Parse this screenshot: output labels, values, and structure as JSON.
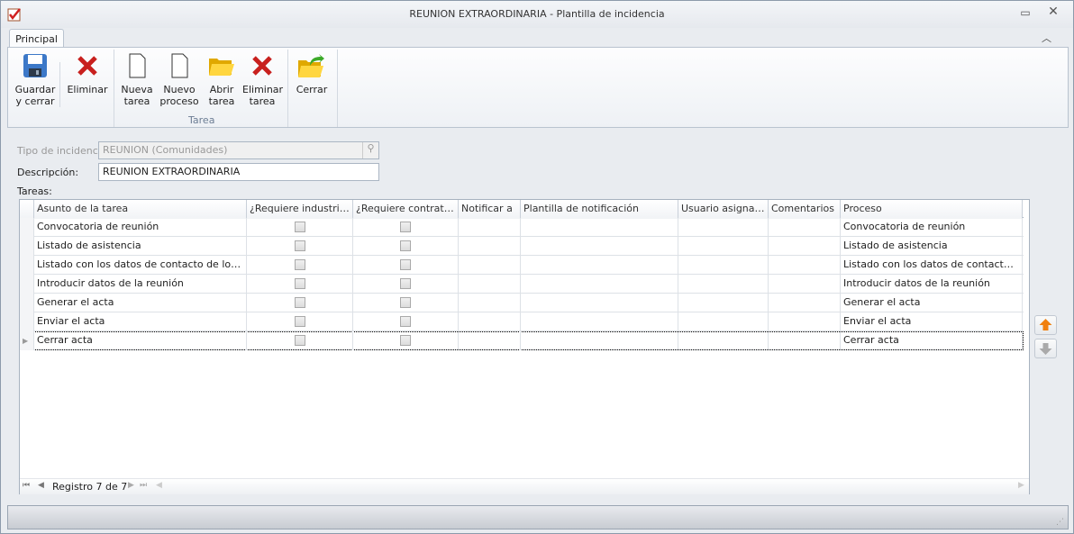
{
  "window": {
    "title": "REUNION EXTRAORDINARIA - Plantilla de incidencia"
  },
  "ribbon": {
    "tab": "Principal",
    "buttons": {
      "guardar": "Guardar\ny cerrar",
      "eliminar": "Eliminar",
      "nueva_tarea": "Nueva\ntarea",
      "nuevo_proceso": "Nuevo\nproceso",
      "abrir_tarea": "Abrir\ntarea",
      "eliminar_tarea": "Eliminar\ntarea",
      "cerrar": "Cerrar"
    },
    "group_tarea": "Tarea"
  },
  "form": {
    "tipo_label": "Tipo de incidencia",
    "tipo_value": "REUNION (Comunidades)",
    "desc_label": "Descripción:",
    "desc_value": "REUNION EXTRAORDINARIA",
    "tareas_label": "Tareas:"
  },
  "grid": {
    "columns": [
      "Asunto de la tarea",
      "¿Requiere industrial?",
      "¿Requiere contrato?",
      "Notificar a",
      "Plantilla de notificación",
      "Usuario asignado",
      "Comentarios",
      "Proceso"
    ],
    "rows": [
      {
        "asunto": "Convocatoria de reunión",
        "industrial": false,
        "contrato": false,
        "proceso": "Convocatoria de reunión"
      },
      {
        "asunto": "Listado de asistencia",
        "industrial": false,
        "contrato": false,
        "proceso": "Listado de asistencia"
      },
      {
        "asunto": "Listado con los datos de contacto de los propi...",
        "industrial": false,
        "contrato": false,
        "proceso": "Listado con los datos de contacto de lo..."
      },
      {
        "asunto": "Introducir datos de la reunión",
        "industrial": false,
        "contrato": false,
        "proceso": "Introducir datos de la reunión"
      },
      {
        "asunto": "Generar el acta",
        "industrial": false,
        "contrato": false,
        "proceso": "Generar el acta"
      },
      {
        "asunto": "Enviar el acta",
        "industrial": false,
        "contrato": false,
        "proceso": "Enviar el acta"
      },
      {
        "asunto": "Cerrar acta",
        "industrial": false,
        "contrato": false,
        "proceso": "Cerrar acta"
      }
    ],
    "navigator": "Registro 7 de 7"
  }
}
